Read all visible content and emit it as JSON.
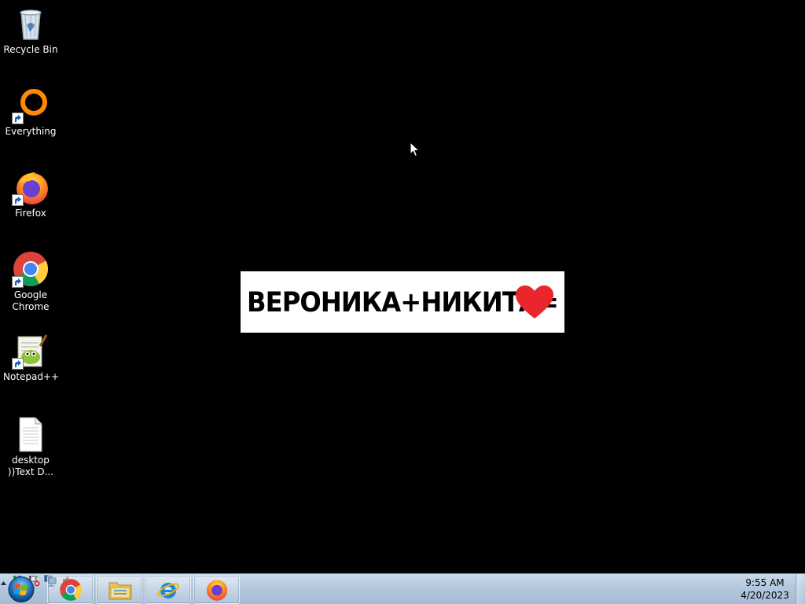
{
  "desktop": {
    "icons": [
      {
        "label": "Recycle Bin"
      },
      {
        "label": "Everything"
      },
      {
        "label": "Firefox"
      },
      {
        "label": "Google Chrome"
      },
      {
        "label": "Notepad++"
      },
      {
        "label": "desktop ))Text D..."
      }
    ],
    "wallpaper_text": "ВЕРОНИКА+НИКИТА="
  },
  "taskbar": {
    "pinned": [
      {
        "icon": "chrome-icon"
      },
      {
        "icon": "file-explorer-icon"
      },
      {
        "icon": "internet-explorer-icon"
      },
      {
        "icon": "firefox-icon"
      }
    ],
    "clock": {
      "time": "9:55 AM",
      "date": "4/20/2023"
    }
  },
  "colors": {
    "heart": "#e8262b",
    "taskbar": "#b3c8de"
  }
}
